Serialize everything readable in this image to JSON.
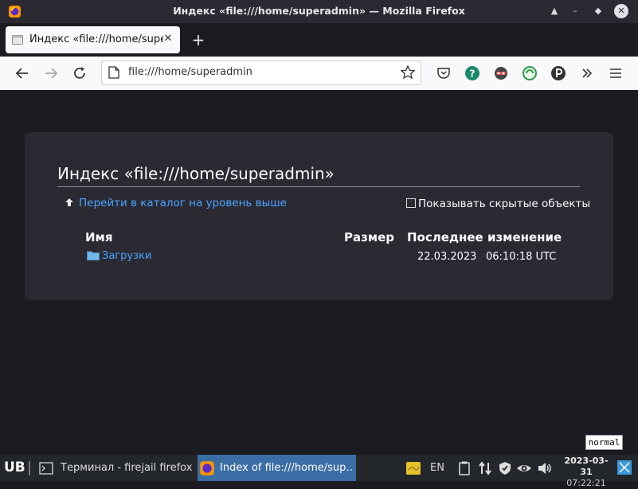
{
  "window": {
    "title": "Индекс «file:///home/superadmin» — Mozilla Firefox",
    "controls": {
      "min": "▲",
      "max": "–",
      "restore": "◆",
      "close": "✕"
    }
  },
  "tabs": [
    {
      "label": "Индекс «file:///home/supera",
      "close": "✕"
    }
  ],
  "newtab_label": "+",
  "navbar": {
    "url": "file:///home/superadmin"
  },
  "page": {
    "heading": "Индекс «file:///home/superadmin»",
    "up_link": "Перейти в каталог на уровень выше",
    "show_hidden": "Показывать скрытые объекты",
    "columns": {
      "name": "Имя",
      "size": "Размер",
      "modified": "Последнее изменение"
    },
    "rows": [
      {
        "name": "Загрузки",
        "size": "",
        "date": "22.03.2023",
        "time": "06:10:18 UTC"
      }
    ]
  },
  "mode_badge": "normal",
  "taskbar": {
    "logo": "UB",
    "items": [
      {
        "label": "Терминал - firejail firefox"
      },
      {
        "label": "Index of file:///home/sup…"
      }
    ],
    "lang": "EN",
    "date": "2023-03-31",
    "time": "07:22:21"
  },
  "colors": {
    "accent": "#4aa3ff",
    "card": "#2b2a33",
    "bg": "#1c1b22",
    "taskbar_active": "#3b6ea5"
  }
}
